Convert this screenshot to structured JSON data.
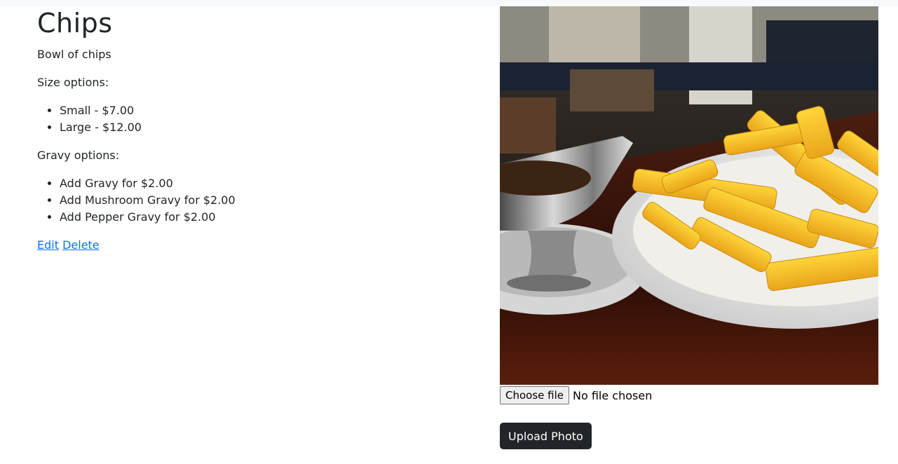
{
  "item": {
    "title": "Chips",
    "description": "Bowl of chips",
    "size_label": "Size options:",
    "sizes": [
      "Small - $7.00",
      "Large - $12.00"
    ],
    "gravy_label": "Gravy options:",
    "gravies": [
      "Add Gravy for $2.00",
      "Add Mushroom Gravy for $2.00",
      "Add Pepper Gravy for $2.00"
    ]
  },
  "actions": {
    "edit": "Edit",
    "delete": "Delete"
  },
  "upload": {
    "choose_file": "Choose file",
    "file_status": "No file chosen",
    "upload_label": "Upload Photo"
  }
}
